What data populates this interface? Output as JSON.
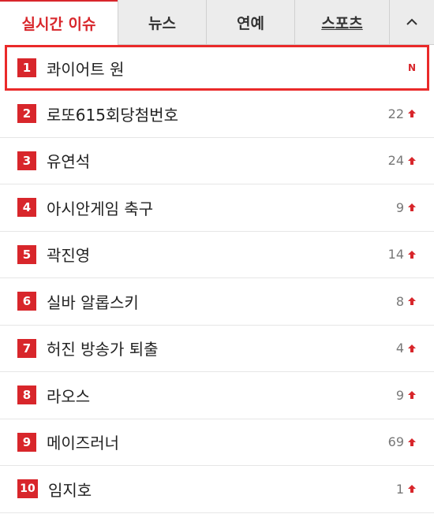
{
  "tabs": [
    {
      "label": "실시간 이슈",
      "active": true
    },
    {
      "label": "뉴스"
    },
    {
      "label": "연예"
    },
    {
      "label": "스포츠"
    }
  ],
  "collapse_icon": "chevron-up-icon",
  "colors": {
    "accent": "#d8262b",
    "highlight_border": "#ea2a2a"
  },
  "items": [
    {
      "rank": "1",
      "term": "콰이어트 원",
      "change": "N",
      "trend": "new"
    },
    {
      "rank": "2",
      "term": "로또615회당첨번호",
      "change": "22",
      "trend": "up"
    },
    {
      "rank": "3",
      "term": "유연석",
      "change": "24",
      "trend": "up"
    },
    {
      "rank": "4",
      "term": "아시안게임 축구",
      "change": "9",
      "trend": "up"
    },
    {
      "rank": "5",
      "term": "곽진영",
      "change": "14",
      "trend": "up"
    },
    {
      "rank": "6",
      "term": "실바 알롭스키",
      "change": "8",
      "trend": "up"
    },
    {
      "rank": "7",
      "term": "허진 방송가 퇴출",
      "change": "4",
      "trend": "up"
    },
    {
      "rank": "8",
      "term": "라오스",
      "change": "9",
      "trend": "up"
    },
    {
      "rank": "9",
      "term": "메이즈러너",
      "change": "69",
      "trend": "up"
    },
    {
      "rank": "10",
      "term": "임지호",
      "change": "1",
      "trend": "up"
    }
  ]
}
